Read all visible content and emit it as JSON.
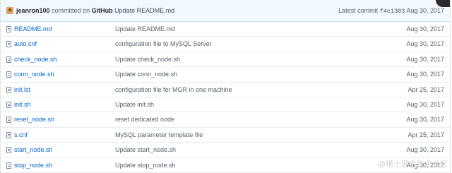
{
  "commit_bar": {
    "author": "jeanron100",
    "committed_on": "committed on",
    "platform": "GitHub",
    "message": "Update README.md",
    "latest_label": "Latest commit",
    "sha": "f4c1303",
    "date": "Aug 30, 2017"
  },
  "files": [
    {
      "name": "README.md",
      "message": "Update README.md",
      "date": "Aug 30, 2017"
    },
    {
      "name": "auto.cnf",
      "message": "configuration file to MySQL Server",
      "date": "Aug 30, 2017"
    },
    {
      "name": "check_node.sh",
      "message": "Update check_node.sh",
      "date": "Aug 30, 2017"
    },
    {
      "name": "conn_node.sh",
      "message": "Update conn_node.sh",
      "date": "Aug 30, 2017"
    },
    {
      "name": "init.lst",
      "message": "configuration file for MGR in one machine",
      "date": "Apr 25, 2017"
    },
    {
      "name": "init.sh",
      "message": "Update init.sh",
      "date": "Aug 30, 2017"
    },
    {
      "name": "reset_node.sh",
      "message": "reset dedicated node",
      "date": "Aug 30, 2017"
    },
    {
      "name": "s.cnf",
      "message": "MySQL parameter template file",
      "date": "Apr 25, 2017"
    },
    {
      "name": "start_node.sh",
      "message": "Update start_node.sh",
      "date": "Aug 30, 2017"
    },
    {
      "name": "stop_node.sh",
      "message": "Update stop_node.sh",
      "date": "Aug 30, 2017"
    }
  ],
  "watermark": "@稀土掘金技术社区",
  "icons": {
    "file": "file-icon",
    "avatar": "avatar"
  }
}
